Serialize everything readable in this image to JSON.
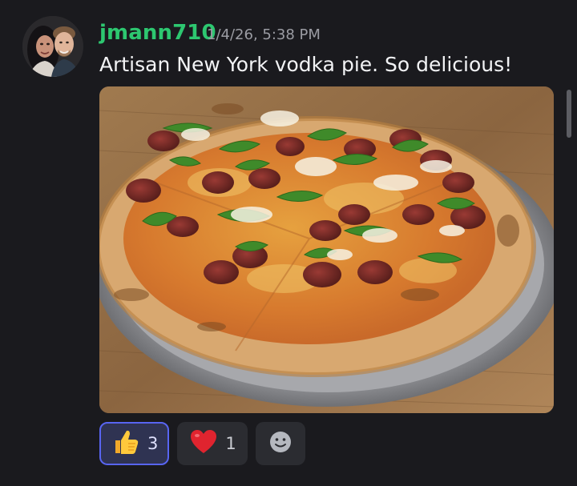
{
  "message": {
    "author": "jmann710",
    "timestamp": "1/4/26, 5:38 PM",
    "text": "Artisan New York vodka pie. So delicious!",
    "author_color": "#2dc770"
  },
  "attachment": {
    "alt": "Pizza with pepperoni, basil and grated cheese on a metal tray"
  },
  "reactions": [
    {
      "emoji": "thumbs-up-emoji",
      "count": "3",
      "active": true
    },
    {
      "emoji": "red-heart-emoji",
      "count": "1",
      "active": false
    }
  ],
  "add_reaction": {
    "icon": "smiley-face-icon"
  },
  "colors": {
    "background": "#1a1a1e",
    "active_reaction_border": "#5865f2",
    "active_reaction_bg": "#2f3352",
    "reaction_bg": "#2b2c31"
  }
}
